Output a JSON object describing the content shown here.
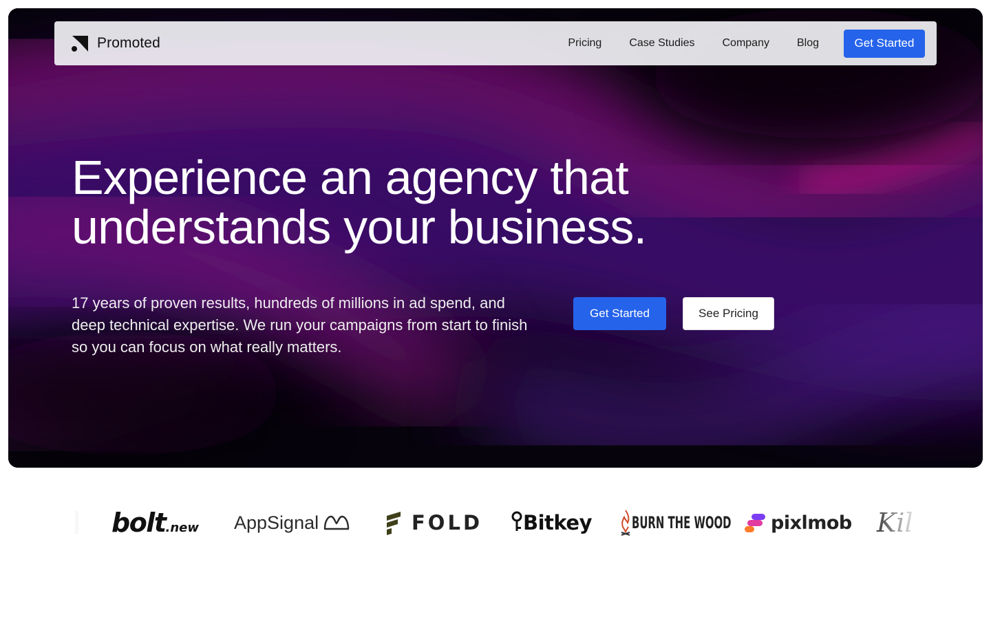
{
  "brand": {
    "name": "Promoted"
  },
  "nav": {
    "links": [
      "Pricing",
      "Case Studies",
      "Company",
      "Blog"
    ],
    "cta_label": "Get Started"
  },
  "hero": {
    "headline_line1": "Experience an agency that",
    "headline_line2": "understands your business.",
    "subtext": "17 years of proven results, hundreds of millions in ad spend, and deep technical expertise. We run your campaigns from start to finish so you can focus on what really matters.",
    "primary_cta": "Get Started",
    "secondary_cta": "See Pricing"
  },
  "client_logos": {
    "bolt_main": "bolt",
    "bolt_suffix": ".new",
    "appsignal": "AppSignal",
    "fold": "FOLD",
    "bitkey": "Bitkey",
    "burnthewood": "BURN THE WOOD",
    "pixlmob": "pixlmob",
    "partial_right": "Kil"
  },
  "colors": {
    "accent": "#2563eb",
    "hero_bg": "#07030d",
    "glow_magenta": "#b0177e",
    "glow_purple": "#5b1e9a"
  }
}
